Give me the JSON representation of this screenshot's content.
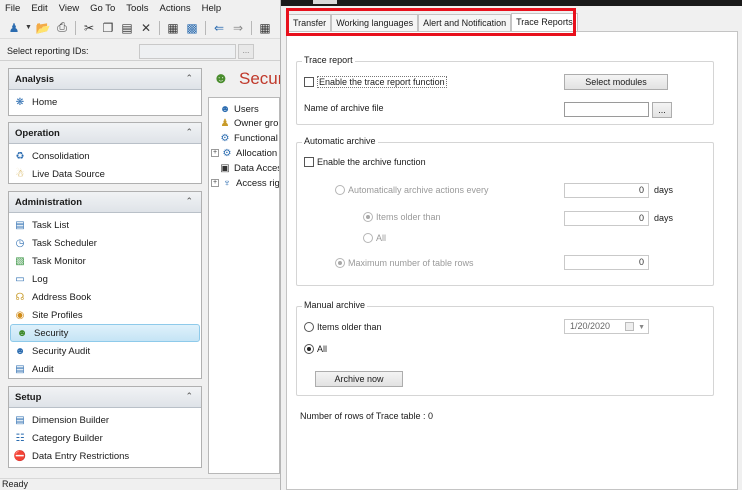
{
  "menubar": [
    "File",
    "Edit",
    "View",
    "Go To",
    "Tools",
    "Actions",
    "Help"
  ],
  "toolbar": {
    "icons": [
      "new-item-icon",
      "dropdown-arrow-icon",
      "open-folder-icon",
      "print-icon",
      "cut-icon",
      "copy-icon",
      "paste-icon",
      "delete-icon",
      "properties-icon",
      "import-icon",
      "back-arrow-icon",
      "forward-arrow-icon",
      "grid-icon"
    ]
  },
  "reporting": {
    "label": "Select reporting IDs:",
    "browse": "..."
  },
  "nav": {
    "analysis": {
      "title": "Analysis",
      "items": [
        "Home"
      ]
    },
    "operation": {
      "title": "Operation",
      "items": [
        "Consolidation",
        "Live Data Source"
      ]
    },
    "administration": {
      "title": "Administration",
      "items": [
        "Task List",
        "Task Scheduler",
        "Task Monitor",
        "Log",
        "Address Book",
        "Site Profiles",
        "Security",
        "Security Audit",
        "Audit"
      ],
      "selected": "Security"
    },
    "setup": {
      "title": "Setup",
      "items": [
        "Dimension Builder",
        "Category Builder",
        "Data Entry Restrictions"
      ]
    }
  },
  "security_pane": {
    "title": "Security",
    "tree": [
      "Users",
      "Owner groups",
      "Functional profiles",
      "Allocation",
      "Data Access",
      "Access rights"
    ]
  },
  "status": {
    "text": "Ready"
  },
  "dialog": {
    "tabs": [
      "Transfer",
      "Working languages",
      "Alert and Notification",
      "Trace Reports"
    ],
    "active_tab": "Trace Reports",
    "highlight_color": "#e8101c",
    "trace_report": {
      "title": "Trace report",
      "enable_label": "Enable the trace report function",
      "select_modules": "Select modules",
      "archive_file_label": "Name of archive file",
      "browse": "..."
    },
    "automatic_archive": {
      "title": "Automatic archive",
      "enable_label": "Enable the archive function",
      "auto_every_label": "Automatically archive actions every",
      "auto_every_value": "0",
      "auto_every_unit": "days",
      "items_older_label": "Items older than",
      "items_older_value": "0",
      "items_older_unit": "days",
      "all_label": "All",
      "max_rows_label": "Maximum number of table rows",
      "max_rows_value": "0"
    },
    "manual_archive": {
      "title": "Manual archive",
      "items_older_label": "Items older than",
      "date_value": "1/20/2020",
      "all_label": "All",
      "archive_now": "Archive now"
    },
    "rows_count_label": "Number of rows of Trace table : 0"
  }
}
